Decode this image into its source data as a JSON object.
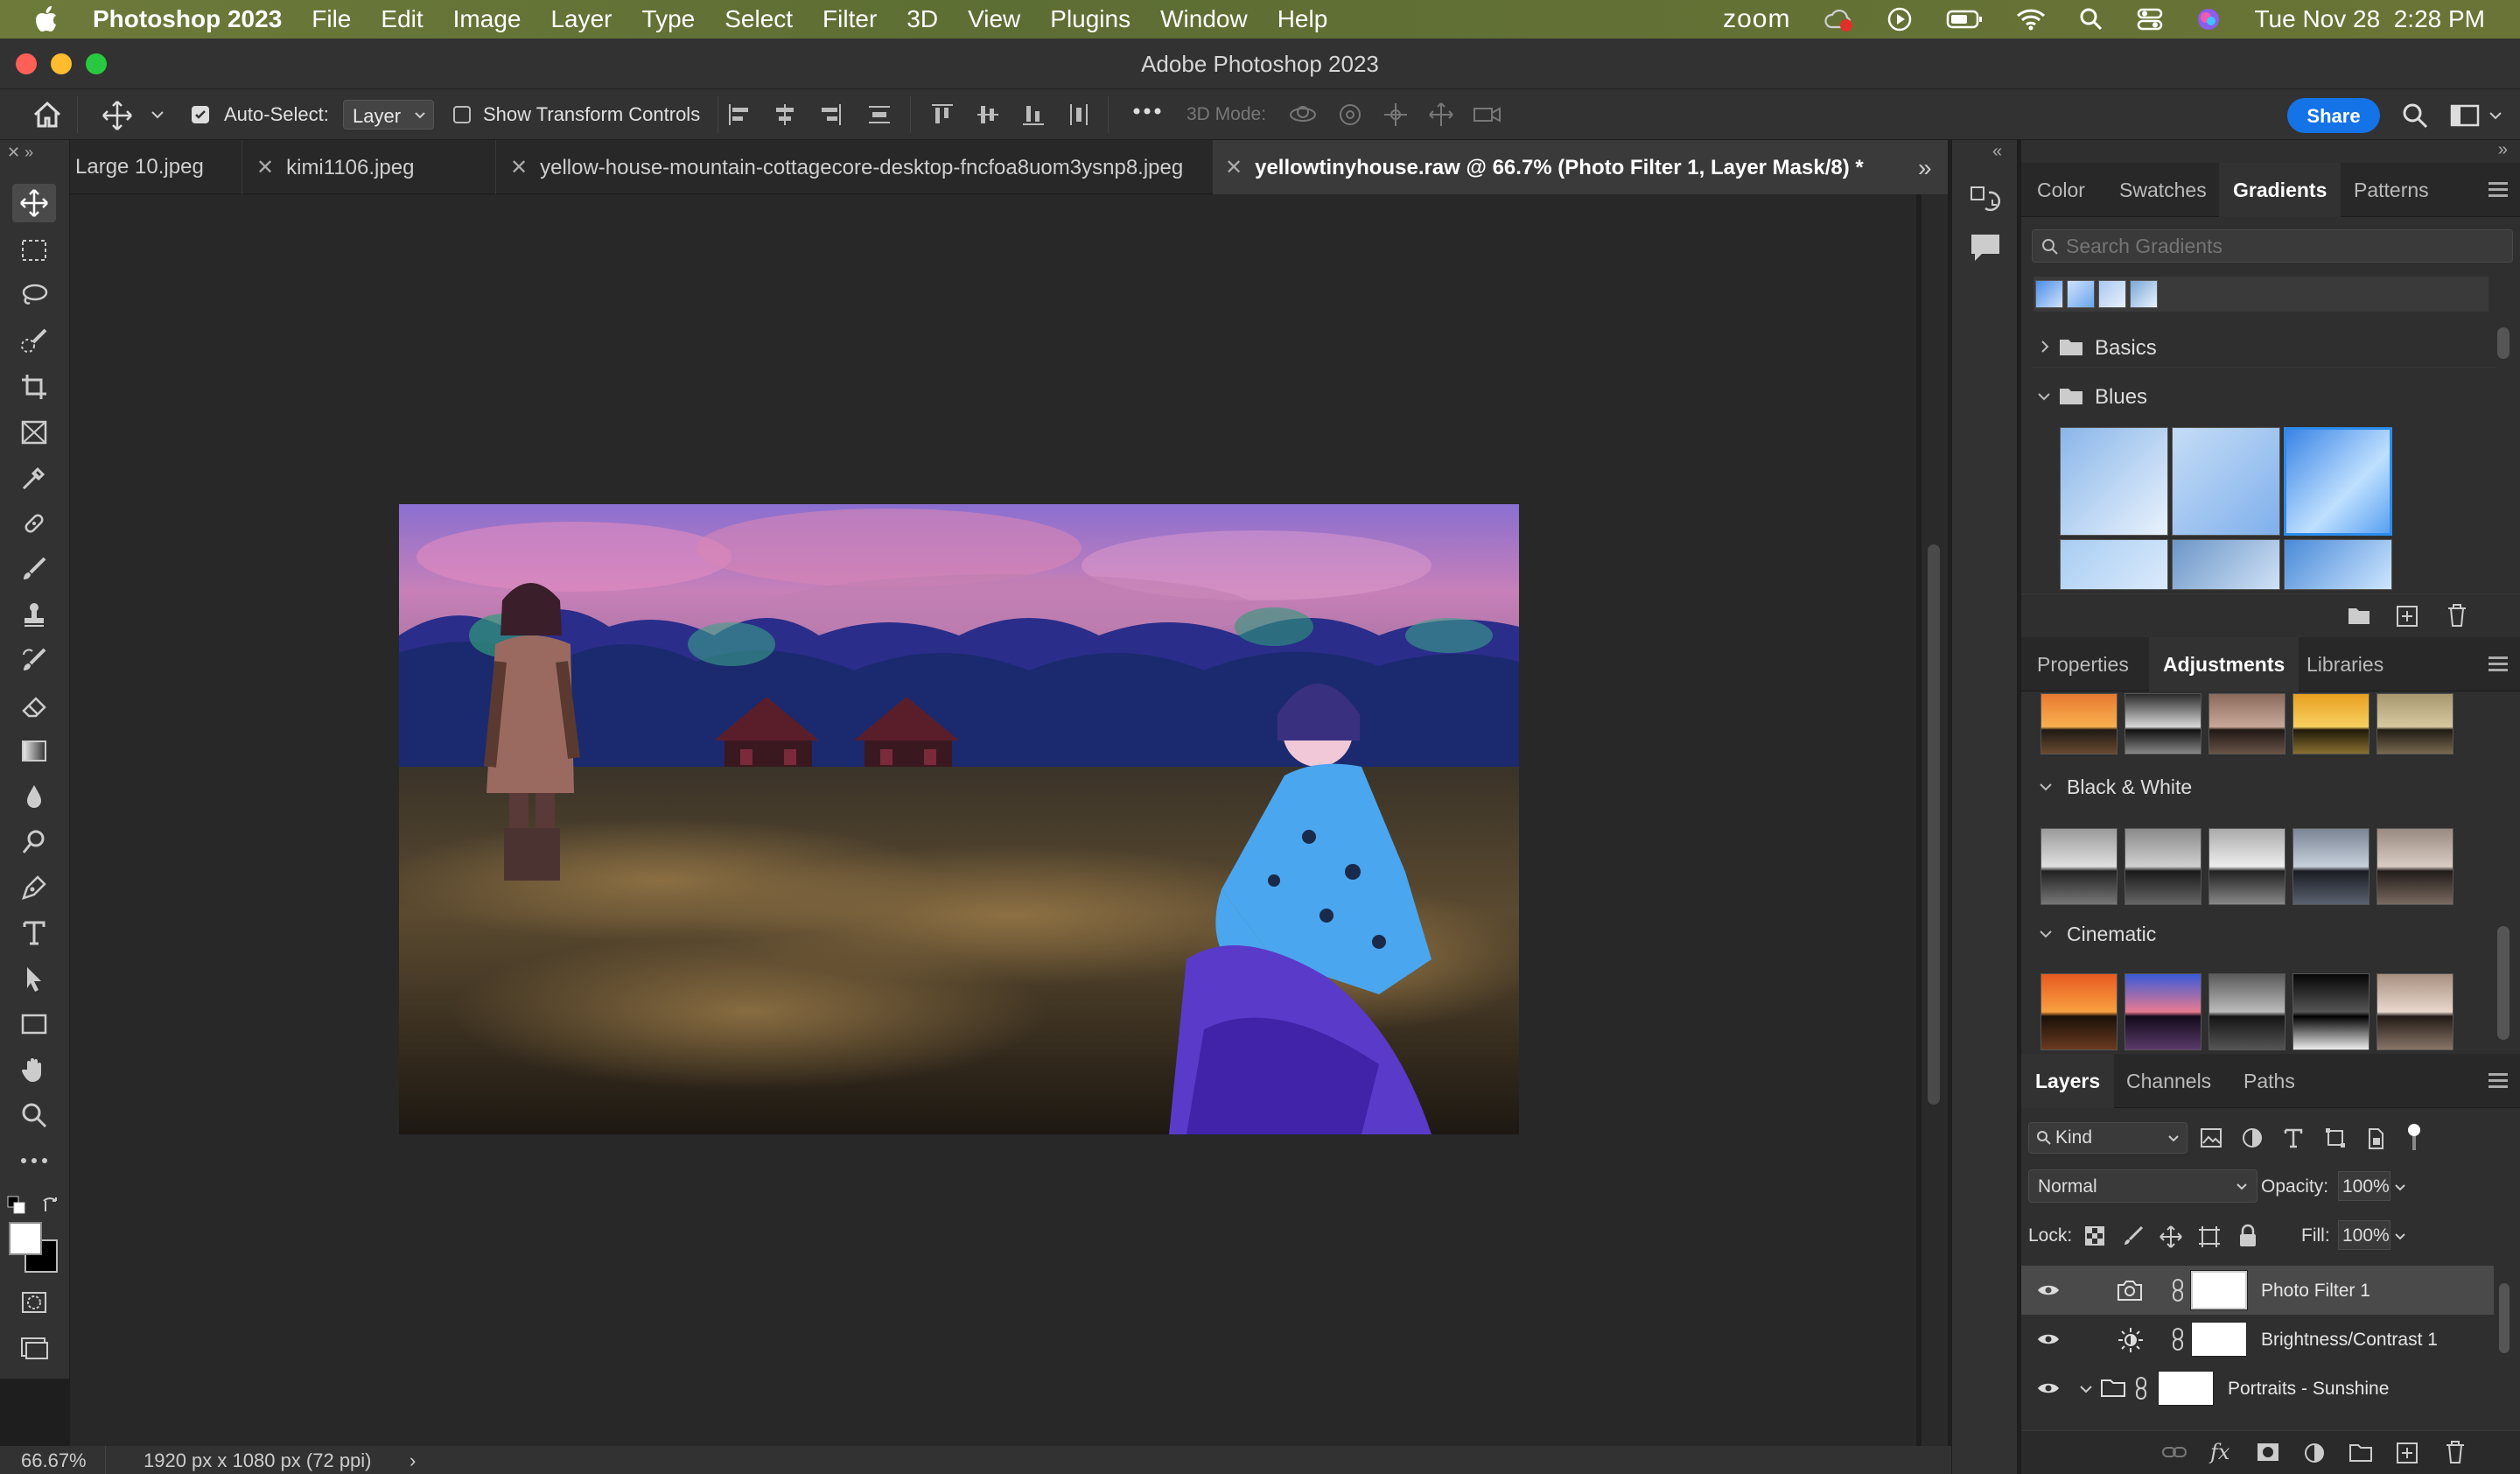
{
  "menubar": {
    "apple_icon": "apple-logo-icon",
    "app_name": "Photoshop 2023",
    "items": [
      "File",
      "Edit",
      "Image",
      "Layer",
      "Type",
      "Select",
      "Filter",
      "3D",
      "View",
      "Plugins",
      "Window",
      "Help"
    ],
    "zoom_label": "zoom",
    "datetime": "Tue Nov 28  2:28 PM"
  },
  "window": {
    "title": "Adobe Photoshop 2023"
  },
  "options": {
    "auto_select_label": "Auto-Select:",
    "auto_select_checked": true,
    "auto_select_value": "Layer",
    "transform_label": "Show Transform Controls",
    "transform_checked": false,
    "mode_3d_label": "3D Mode:",
    "share_label": "Share"
  },
  "tabs": [
    {
      "label": "Large 10.jpeg",
      "active": false
    },
    {
      "label": "kimi1106.jpeg",
      "active": false
    },
    {
      "label": "yellow-house-mountain-cottagecore-desktop-fncfoa8uom3ysnp8.jpeg",
      "active": false
    },
    {
      "label": "yellowtinyhouse.raw @ 66.7% (Photo Filter 1, Layer Mask/8) *",
      "active": true
    }
  ],
  "status": {
    "zoom": "66.67%",
    "doc_info": "1920 px x 1080 px (72 ppi)"
  },
  "gradients_panel": {
    "tabs": [
      "Color",
      "Swatches",
      "Gradients",
      "Patterns"
    ],
    "active_tab": "Gradients",
    "search_placeholder": "Search Gradients",
    "groups": [
      {
        "label": "Basics",
        "expanded": false
      },
      {
        "label": "Blues",
        "expanded": true
      }
    ]
  },
  "adjustments_panel": {
    "tabs": [
      "Properties",
      "Adjustments",
      "Libraries"
    ],
    "active_tab": "Adjustments",
    "sections": [
      {
        "label": "Black & White",
        "expanded": true
      },
      {
        "label": "Cinematic",
        "expanded": true
      }
    ]
  },
  "layers_panel": {
    "tabs": [
      "Layers",
      "Channels",
      "Paths"
    ],
    "active_tab": "Layers",
    "filter_label": "Kind",
    "blend_mode": "Normal",
    "opacity_label": "Opacity:",
    "opacity_value": "100%",
    "lock_label": "Lock:",
    "fill_label": "Fill:",
    "fill_value": "100%",
    "layers": [
      {
        "name": "Photo Filter 1",
        "type_icon": "camera-adjustment-icon",
        "visible": true,
        "selected": true
      },
      {
        "name": "Brightness/Contrast 1",
        "type_icon": "sun-adjustment-icon",
        "visible": true,
        "selected": false
      },
      {
        "name": "Portraits - Sunshine",
        "type_icon": "folder-icon",
        "visible": true,
        "selected": false
      }
    ]
  },
  "colors": {
    "accent": "#1473e6",
    "menubar_bg": "#5d6e34",
    "panel_bg": "#2f2f2f",
    "canvas_bg": "#282828"
  }
}
